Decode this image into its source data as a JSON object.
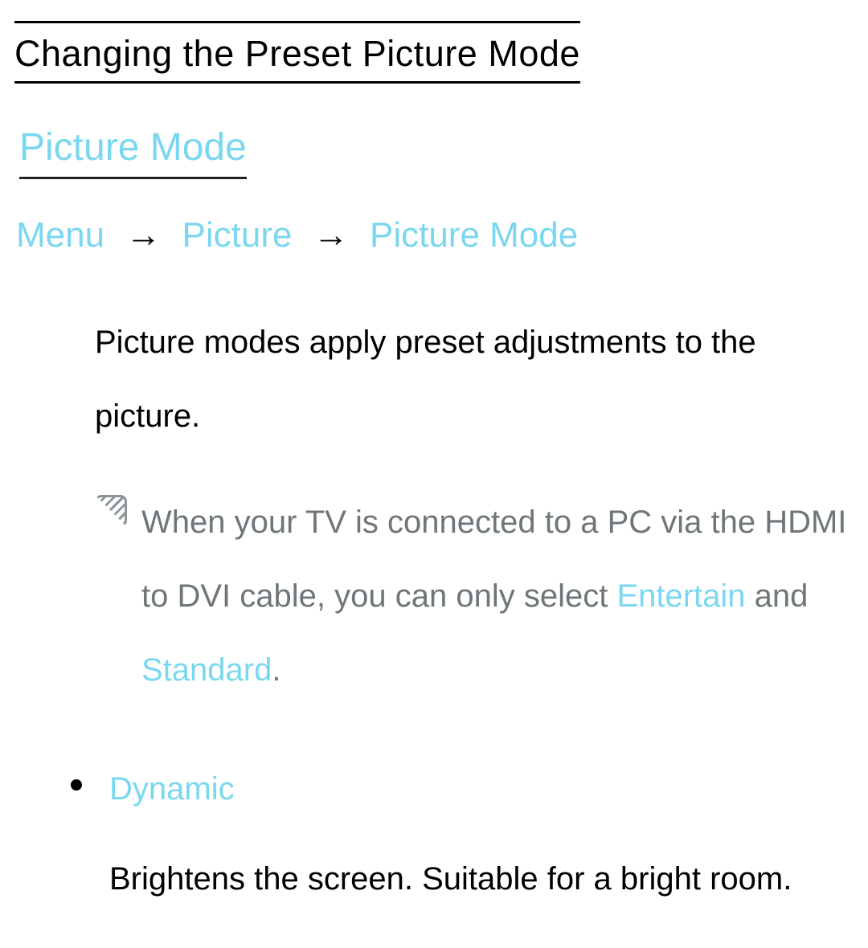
{
  "page_title": "Changing the Preset Picture Mode",
  "section_title": "Picture Mode",
  "breadcrumb": {
    "items": [
      "Menu",
      "Picture",
      "Picture Mode"
    ],
    "separator": "→"
  },
  "intro_para": "Picture modes apply preset adjustments to the picture.",
  "note": {
    "pre": "When your TV is connected to a PC via the HDMI to DVI cable, you can only select ",
    "accent1": "Entertain",
    "mid": " and ",
    "accent2": "Standard",
    "post": "."
  },
  "modes": [
    {
      "name": "Dynamic",
      "desc": "Brightens the screen. Suitable for a bright room."
    }
  ]
}
